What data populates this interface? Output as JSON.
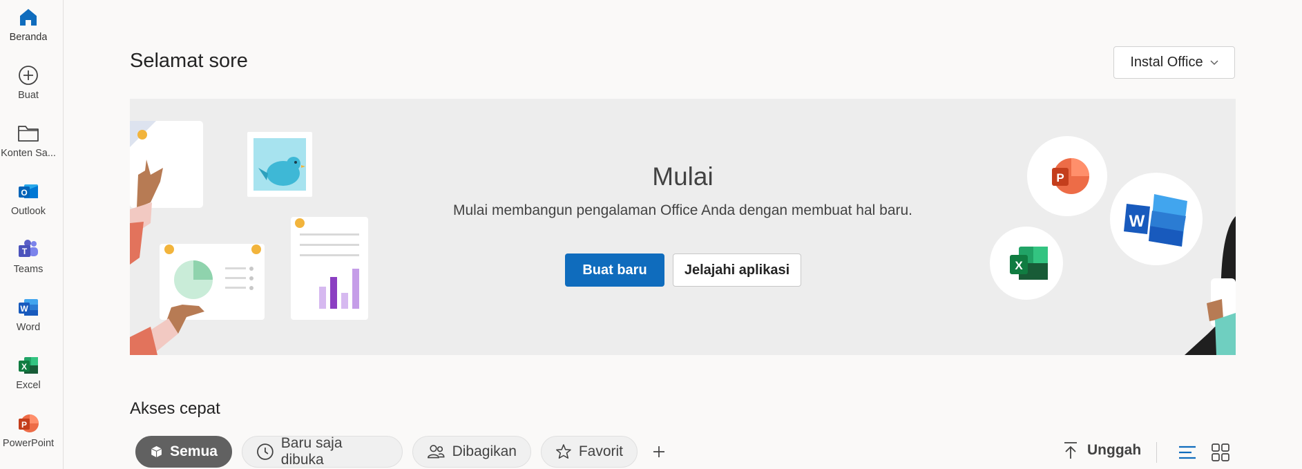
{
  "sidebar": {
    "items": [
      {
        "label": "Beranda",
        "icon": "home-icon",
        "active": true
      },
      {
        "label": "Buat",
        "icon": "add-circle-icon"
      },
      {
        "label": "Konten Sa...",
        "icon": "folder-icon"
      },
      {
        "label": "Outlook",
        "icon": "outlook-icon"
      },
      {
        "label": "Teams",
        "icon": "teams-icon"
      },
      {
        "label": "Word",
        "icon": "word-icon"
      },
      {
        "label": "Excel",
        "icon": "excel-icon"
      },
      {
        "label": "PowerPoint",
        "icon": "powerpoint-icon"
      }
    ]
  },
  "header": {
    "greeting": "Selamat sore",
    "install_label": "Instal Office"
  },
  "hero": {
    "title": "Mulai",
    "subtitle": "Mulai membangun pengalaman Office Anda dengan membuat hal baru.",
    "primary_label": "Buat baru",
    "secondary_label": "Jelajahi aplikasi"
  },
  "quick_access": {
    "title": "Akses cepat",
    "filters": [
      {
        "label": "Semua",
        "icon": "cube-icon",
        "active": true
      },
      {
        "label": "Baru saja dibuka",
        "icon": "clock-icon"
      },
      {
        "label": "Dibagikan",
        "icon": "people-icon"
      },
      {
        "label": "Favorit",
        "icon": "star-icon"
      }
    ],
    "upload_label": "Unggah"
  },
  "colors": {
    "accent": "#0f6cbd",
    "word": "#185abd",
    "excel": "#107c41",
    "powerpoint": "#c43e1c",
    "outlook": "#0078d4",
    "teams": "#5b5fc7"
  }
}
